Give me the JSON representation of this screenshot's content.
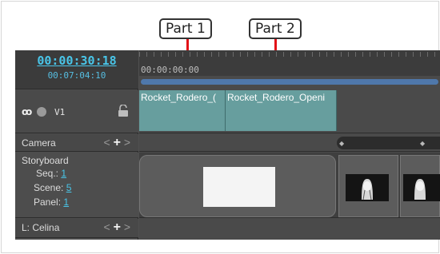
{
  "callouts": {
    "part1": "Part 1",
    "part2": "Part 2"
  },
  "timecode": {
    "current": "00:00:30:18",
    "total": "00:07:04:10"
  },
  "tracks": {
    "video": {
      "label": "V1"
    },
    "camera": {
      "label": "Camera"
    },
    "storyboard": {
      "label": "Storyboard",
      "seq_label": "Seq.:",
      "seq_value": "1",
      "scene_label": "Scene:",
      "scene_value": "5",
      "panel_label": "Panel:",
      "panel_value": "1"
    },
    "layer": {
      "label": "L: Celina"
    }
  },
  "controls": {
    "prev": "<",
    "add": "+",
    "next": ">"
  },
  "ruler": {
    "time": "00:00:00:00"
  },
  "clips": [
    "Rocket_Rodero_(",
    "Rocket_Rodero_Openi"
  ],
  "colors": {
    "accent": "#49c5e8",
    "callout_line": "#e21218",
    "clip": "#679e9e",
    "scrubber": "#4f78ab"
  }
}
